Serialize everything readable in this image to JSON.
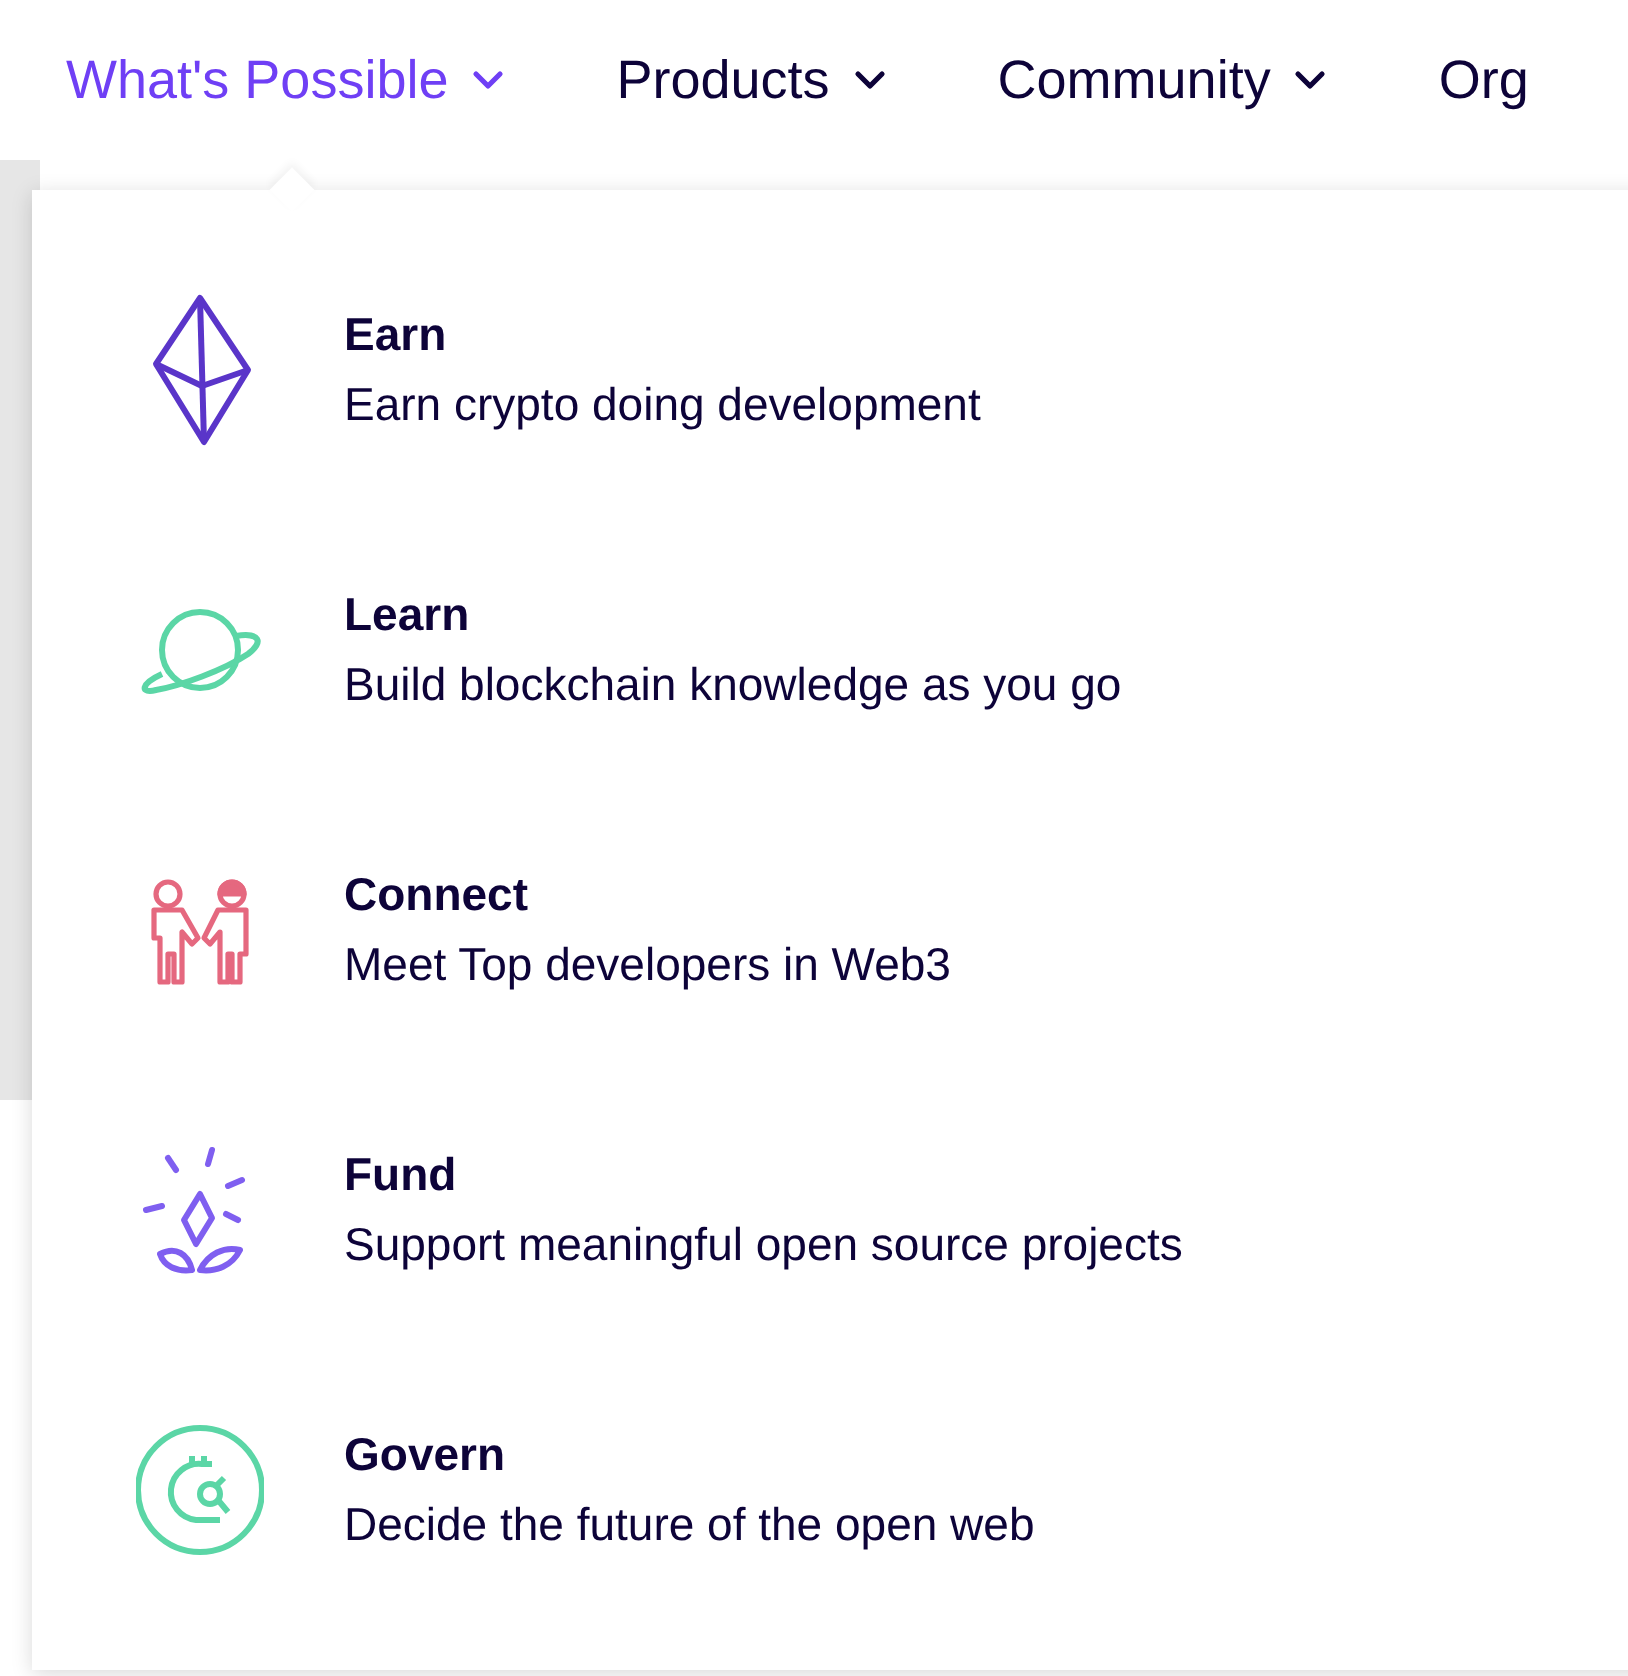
{
  "nav": [
    {
      "label": "What's Possible",
      "selected": true,
      "chevron": true
    },
    {
      "label": "Products",
      "selected": false,
      "chevron": true
    },
    {
      "label": "Community",
      "selected": false,
      "chevron": true
    },
    {
      "label": "Org",
      "selected": false,
      "chevron": false
    }
  ],
  "menu": {
    "items": [
      {
        "kind": "diamond",
        "title": "Earn",
        "description": "Earn crypto doing development"
      },
      {
        "kind": "planet",
        "title": "Learn",
        "description": "Build blockchain knowledge as you go"
      },
      {
        "kind": "people",
        "title": "Connect",
        "description": "Meet Top developers in Web3"
      },
      {
        "kind": "sprout",
        "title": "Fund",
        "description": "Support meaningful open source projects"
      },
      {
        "kind": "coin",
        "title": "Govern",
        "description": "Decide the future of the open web"
      }
    ]
  }
}
